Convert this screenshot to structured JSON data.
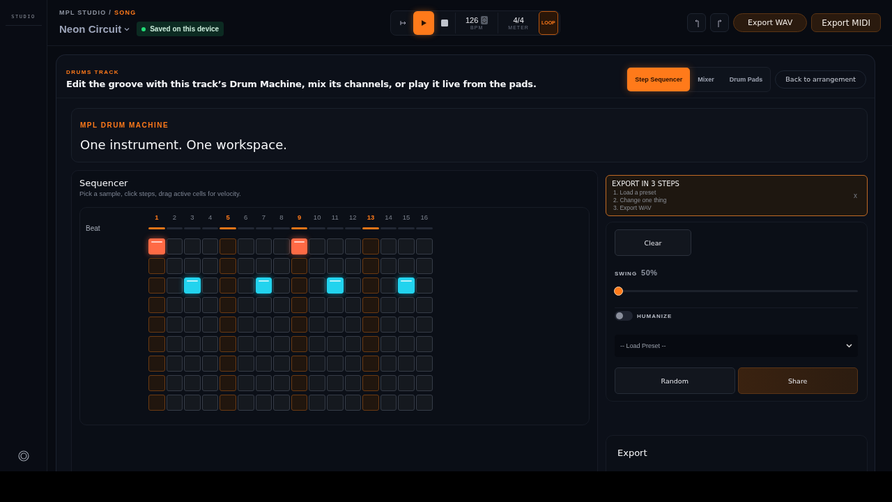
{
  "sidebar": {
    "label": "STUDIO"
  },
  "header": {
    "breadcrumb": {
      "root": "MPL STUDIO",
      "separator": "/",
      "current": "SONG"
    },
    "song_title": "Neon Circuit",
    "status": {
      "text": "Saved on this device",
      "color": "#22dd77"
    }
  },
  "transport": {
    "playing": true,
    "bpm": "126",
    "bpm_label": "BPM",
    "meter": "4/4",
    "meter_label": "METER",
    "loop": {
      "label": "LOOP",
      "on": true
    }
  },
  "actions": [
    {
      "label": "Export WAV"
    },
    {
      "label": "Export MIDI"
    }
  ],
  "track": {
    "eyebrow": "DRUMS TRACK",
    "title": "Edit the groove with this track’s Drum Machine, mix its channels, or play it live from the pads.",
    "tabs": [
      {
        "label": "Step Sequencer",
        "selected": true
      },
      {
        "label": "Mixer",
        "selected": false
      },
      {
        "label": "Drum Pads",
        "selected": false
      }
    ],
    "back": "Back to arrangement"
  },
  "machine": {
    "eyebrow": "MPL DRUM MACHINE",
    "title": "One instrument. One workspace."
  },
  "sequencer": {
    "title": "Sequencer",
    "hint": "Pick a sample, click steps, drag active cells for velocity.",
    "beat_label": "Beat",
    "steps": [
      {
        "label": "1",
        "accent": true
      },
      {
        "label": "2",
        "accent": false
      },
      {
        "label": "3",
        "accent": false
      },
      {
        "label": "4",
        "accent": false
      },
      {
        "label": "5",
        "accent": true
      },
      {
        "label": "6",
        "accent": false
      },
      {
        "label": "7",
        "accent": false
      },
      {
        "label": "8",
        "accent": false
      },
      {
        "label": "9",
        "accent": true
      },
      {
        "label": "10",
        "accent": false
      },
      {
        "label": "11",
        "accent": false
      },
      {
        "label": "12",
        "accent": false
      },
      {
        "label": "13",
        "accent": true
      },
      {
        "label": "14",
        "accent": false
      },
      {
        "label": "15",
        "accent": false
      },
      {
        "label": "16",
        "accent": false
      }
    ],
    "rows": [
      {
        "color": "#ff6a45",
        "cells": [
          true,
          false,
          false,
          false,
          false,
          false,
          false,
          false,
          true,
          false,
          false,
          false,
          false,
          false,
          false,
          false
        ]
      },
      {
        "cells": [
          false,
          false,
          false,
          false,
          false,
          false,
          false,
          false,
          false,
          false,
          false,
          false,
          false,
          false,
          false,
          false
        ]
      },
      {
        "color": "#22d3ee",
        "cells": [
          false,
          false,
          true,
          false,
          false,
          false,
          true,
          false,
          false,
          false,
          true,
          false,
          false,
          false,
          true,
          false
        ]
      },
      {
        "cells": [
          false,
          false,
          false,
          false,
          false,
          false,
          false,
          false,
          false,
          false,
          false,
          false,
          false,
          false,
          false,
          false
        ]
      },
      {
        "cells": [
          false,
          false,
          false,
          false,
          false,
          false,
          false,
          false,
          false,
          false,
          false,
          false,
          false,
          false,
          false,
          false
        ]
      },
      {
        "cells": [
          false,
          false,
          false,
          false,
          false,
          false,
          false,
          false,
          false,
          false,
          false,
          false,
          false,
          false,
          false,
          false
        ]
      },
      {
        "cells": [
          false,
          false,
          false,
          false,
          false,
          false,
          false,
          false,
          false,
          false,
          false,
          false,
          false,
          false,
          false,
          false
        ]
      },
      {
        "cells": [
          false,
          false,
          false,
          false,
          false,
          false,
          false,
          false,
          false,
          false,
          false,
          false,
          false,
          false,
          false,
          false
        ]
      },
      {
        "cells": [
          false,
          false,
          false,
          false,
          false,
          false,
          false,
          false,
          false,
          false,
          false,
          false,
          false,
          false,
          false,
          false
        ]
      }
    ]
  },
  "tips": {
    "title": "EXPORT IN 3 STEPS",
    "steps": [
      "1. Load a preset",
      "2. Change one thing",
      "3. Export WAV"
    ],
    "close": "x"
  },
  "controls": {
    "clear": "Clear",
    "swing": {
      "label": "SWING",
      "reading": "50%",
      "level": 0
    },
    "humanize": {
      "label": "HUMANIZE",
      "on": false
    },
    "preset": {
      "placeholder": "-- Load Preset --"
    },
    "buttons": [
      {
        "label": "Random",
        "kind": "plain"
      },
      {
        "label": "Share",
        "kind": "accent"
      }
    ]
  },
  "export": {
    "title": "Export"
  }
}
